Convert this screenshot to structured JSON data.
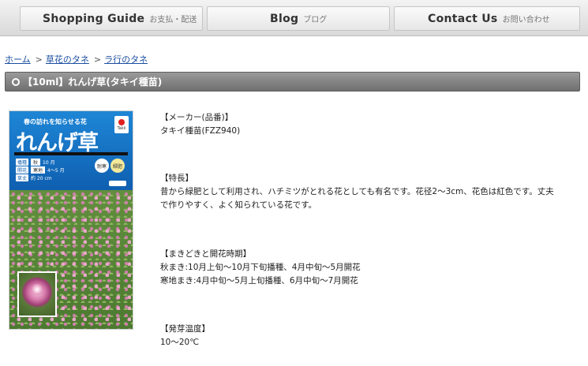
{
  "nav": {
    "shopping_en": "Shopping Guide",
    "shopping_ja": "お支払・配送",
    "blog_en": "Blog",
    "blog_ja": "ブログ",
    "contact_en": "Contact Us",
    "contact_ja": "お問い合わせ"
  },
  "breadcrumb": {
    "home": "ホーム",
    "category": "草花のタネ",
    "subcategory": "ラ行のタネ",
    "separator": ">"
  },
  "product_title": "【10ml】れんげ草(タキイ種苗)",
  "package": {
    "tagline": "春の訪れを知らせる花",
    "name": "れんげ草",
    "logo_text": "Takii",
    "row1_tag": "播種",
    "row1_season": "秋",
    "row1_value": "10 月",
    "row2_tag": "開花",
    "row2_season": "寒地",
    "row2_value": "4～5 月",
    "row3_tag": "草丈",
    "row3_value": "約 20 cm",
    "badge1": "耐寒",
    "badge2": "緑肥"
  },
  "description": {
    "maker_heading": "【メーカー(品番)】",
    "maker_value": "タキイ種苗(FZZ940)",
    "features_heading": "【特長】",
    "features_line1": "昔から緑肥として利用され、ハチミツがとれる花としても有名です。花径2～3cm、花色は紅色です。丈夫",
    "features_line2": "で作りやすく、よく知られている花です。",
    "sowing_heading": "【まきどきと開花時期】",
    "sowing_line1": "秋まき:10月上旬～10月下旬播種、4月中旬～5月開花",
    "sowing_line2": "寒地まき:4月中旬～5月上旬播種、6月中旬～7月開花",
    "temp_heading": "【発芽温度】",
    "temp_value": "10～20℃"
  },
  "colors": {
    "title_bar": "#7f7f7f",
    "link": "#1a4ea0",
    "package_blue": "#1472c4"
  }
}
